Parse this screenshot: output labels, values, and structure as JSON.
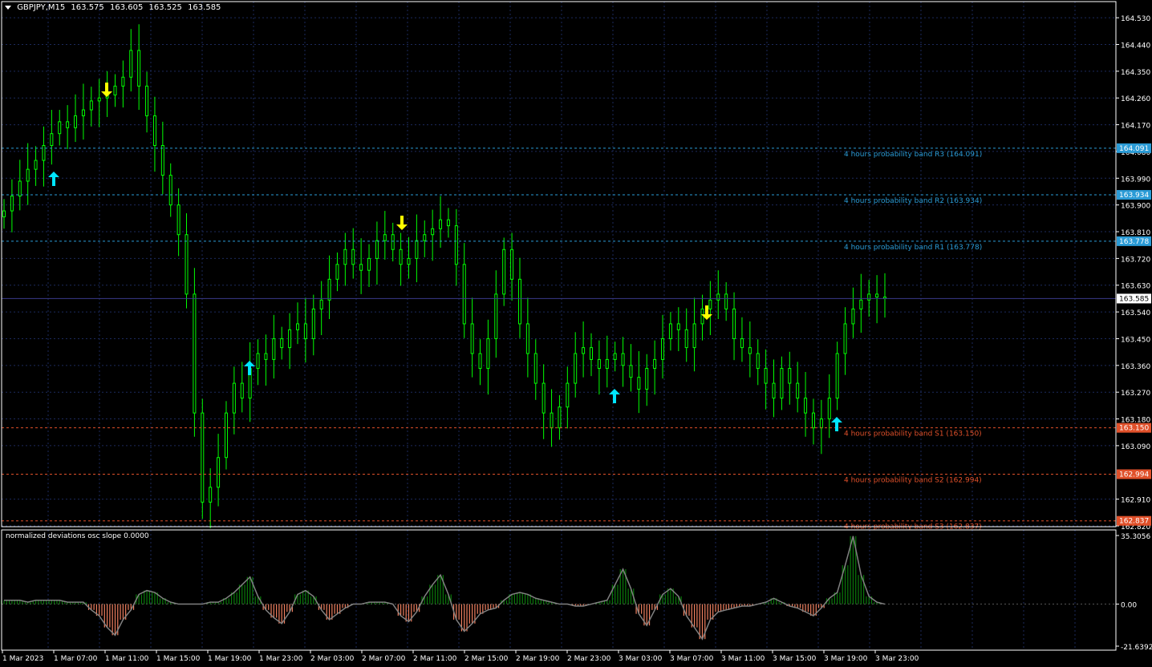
{
  "header": {
    "symbol": "GBPJPY,M15",
    "open": "163.575",
    "high": "163.605",
    "low": "163.525",
    "close": "163.585"
  },
  "colors": {
    "background": "#000000",
    "grid": "#1c2a5c",
    "candle": "#00ff00",
    "resistance": "#2a9bd6",
    "support": "#e0502a",
    "arrow_up": "#00e5ff",
    "arrow_down": "#ffff00",
    "osc_positive": "#0a7a0a",
    "osc_negative": "#f08060",
    "osc_line": "#808080"
  },
  "price_axis": {
    "labels": [
      "164.530",
      "164.440",
      "164.350",
      "164.260",
      "164.170",
      "164.080",
      "163.990",
      "163.900",
      "163.810",
      "163.720",
      "163.630",
      "163.540",
      "163.450",
      "163.360",
      "163.270",
      "163.180",
      "163.090",
      "162.910",
      "162.820"
    ],
    "current_price": "163.585"
  },
  "time_axis": {
    "labels": [
      "1 Mar 2023",
      "1 Mar 07:00",
      "1 Mar 11:00",
      "1 Mar 15:00",
      "1 Mar 19:00",
      "1 Mar 23:00",
      "2 Mar 03:00",
      "2 Mar 07:00",
      "2 Mar 11:00",
      "2 Mar 15:00",
      "2 Mar 19:00",
      "2 Mar 23:00",
      "3 Mar 03:00",
      "3 Mar 07:00",
      "3 Mar 11:00",
      "3 Mar 15:00",
      "3 Mar 19:00",
      "3 Mar 23:00"
    ]
  },
  "bands": [
    {
      "name": "R3",
      "price": "164.091",
      "label": "4 hours probability band R3 (164.091)",
      "kind": "resistance"
    },
    {
      "name": "R2",
      "price": "163.934",
      "label": "4 hours probability band R2 (163.934)",
      "kind": "resistance"
    },
    {
      "name": "R1",
      "price": "163.778",
      "label": "4 hours probability band R1 (163.778)",
      "kind": "resistance"
    },
    {
      "name": "S1",
      "price": "163.150",
      "label": "4 hours probability band S1 (163.150)",
      "kind": "support"
    },
    {
      "name": "S2",
      "price": "162.994",
      "label": "4 hours probability band S2 (162.994)",
      "kind": "support"
    },
    {
      "name": "S3",
      "price": "162.837",
      "label": "4 hours probability band S3 (162.837)",
      "kind": "support"
    }
  ],
  "oscillator": {
    "title": "normalized deviations osc slope 0.0000",
    "axis_labels": [
      "35.3056",
      "0.00",
      "-21.6392"
    ],
    "max": 35.3056,
    "min": -21.6392
  },
  "chart_data": {
    "type": "candlestick",
    "symbol": "GBPJPY",
    "timeframe": "M15",
    "price_range": [
      162.82,
      164.56
    ],
    "closes": [
      163.88,
      163.93,
      163.98,
      164.02,
      164.05,
      164.1,
      164.14,
      164.18,
      164.16,
      164.2,
      164.22,
      164.25,
      164.26,
      164.27,
      164.3,
      164.33,
      164.42,
      164.3,
      164.2,
      164.1,
      164.0,
      163.9,
      163.8,
      163.6,
      163.2,
      162.9,
      162.95,
      163.05,
      163.2,
      163.3,
      163.25,
      163.35,
      163.4,
      163.38,
      163.45,
      163.42,
      163.48,
      163.5,
      163.45,
      163.55,
      163.58,
      163.65,
      163.7,
      163.75,
      163.7,
      163.68,
      163.72,
      163.78,
      163.8,
      163.75,
      163.7,
      163.72,
      163.78,
      163.8,
      163.82,
      163.85,
      163.83,
      163.7,
      163.5,
      163.4,
      163.35,
      163.45,
      163.6,
      163.75,
      163.65,
      163.5,
      163.4,
      163.3,
      163.2,
      163.15,
      163.22,
      163.3,
      163.4,
      163.42,
      163.38,
      163.35,
      163.38,
      163.4,
      163.36,
      163.32,
      163.28,
      163.35,
      163.38,
      163.45,
      163.5,
      163.48,
      163.42,
      163.5,
      163.55,
      163.58,
      163.6,
      163.55,
      163.45,
      163.42,
      163.4,
      163.35,
      163.3,
      163.25,
      163.35,
      163.3,
      163.25,
      163.2,
      163.15,
      163.18,
      163.25,
      163.4,
      163.5,
      163.55,
      163.58,
      163.6,
      163.59,
      163.585
    ],
    "signals": [
      {
        "type": "up",
        "time": "1 Mar 05:00"
      },
      {
        "type": "down",
        "time": "1 Mar 09:00"
      },
      {
        "type": "up",
        "time": "1 Mar 20:00"
      },
      {
        "type": "down",
        "time": "2 Mar 08:00"
      },
      {
        "type": "up",
        "time": "3 Mar 02:00"
      },
      {
        "type": "down",
        "time": "3 Mar 07:00"
      },
      {
        "type": "up",
        "time": "3 Mar 17:00"
      }
    ],
    "oscillator_values": [
      2,
      2,
      2,
      1,
      2,
      2,
      2,
      2,
      1,
      1,
      1,
      -3,
      -6,
      -12,
      -16,
      -8,
      -3,
      5,
      7,
      6,
      3,
      1,
      0,
      0,
      0,
      0,
      1,
      1,
      3,
      6,
      10,
      14,
      4,
      -3,
      -7,
      -10,
      -4,
      5,
      7,
      4,
      -3,
      -8,
      -5,
      -2,
      0,
      0,
      1,
      1,
      1,
      0,
      -6,
      -9,
      -4,
      4,
      10,
      15,
      5,
      -8,
      -14,
      -10,
      -5,
      -3,
      -2,
      2,
      5,
      6,
      5,
      3,
      2,
      1,
      0,
      0,
      -1,
      -1,
      0,
      1,
      2,
      10,
      18,
      8,
      -5,
      -11,
      -3,
      5,
      8,
      4,
      -6,
      -12,
      -18,
      -8,
      -4,
      -3,
      -2,
      -1,
      -1,
      0,
      1,
      3,
      1,
      -1,
      -2,
      -4,
      -6,
      -2,
      3,
      6,
      20,
      35,
      15,
      4,
      1,
      0
    ]
  }
}
